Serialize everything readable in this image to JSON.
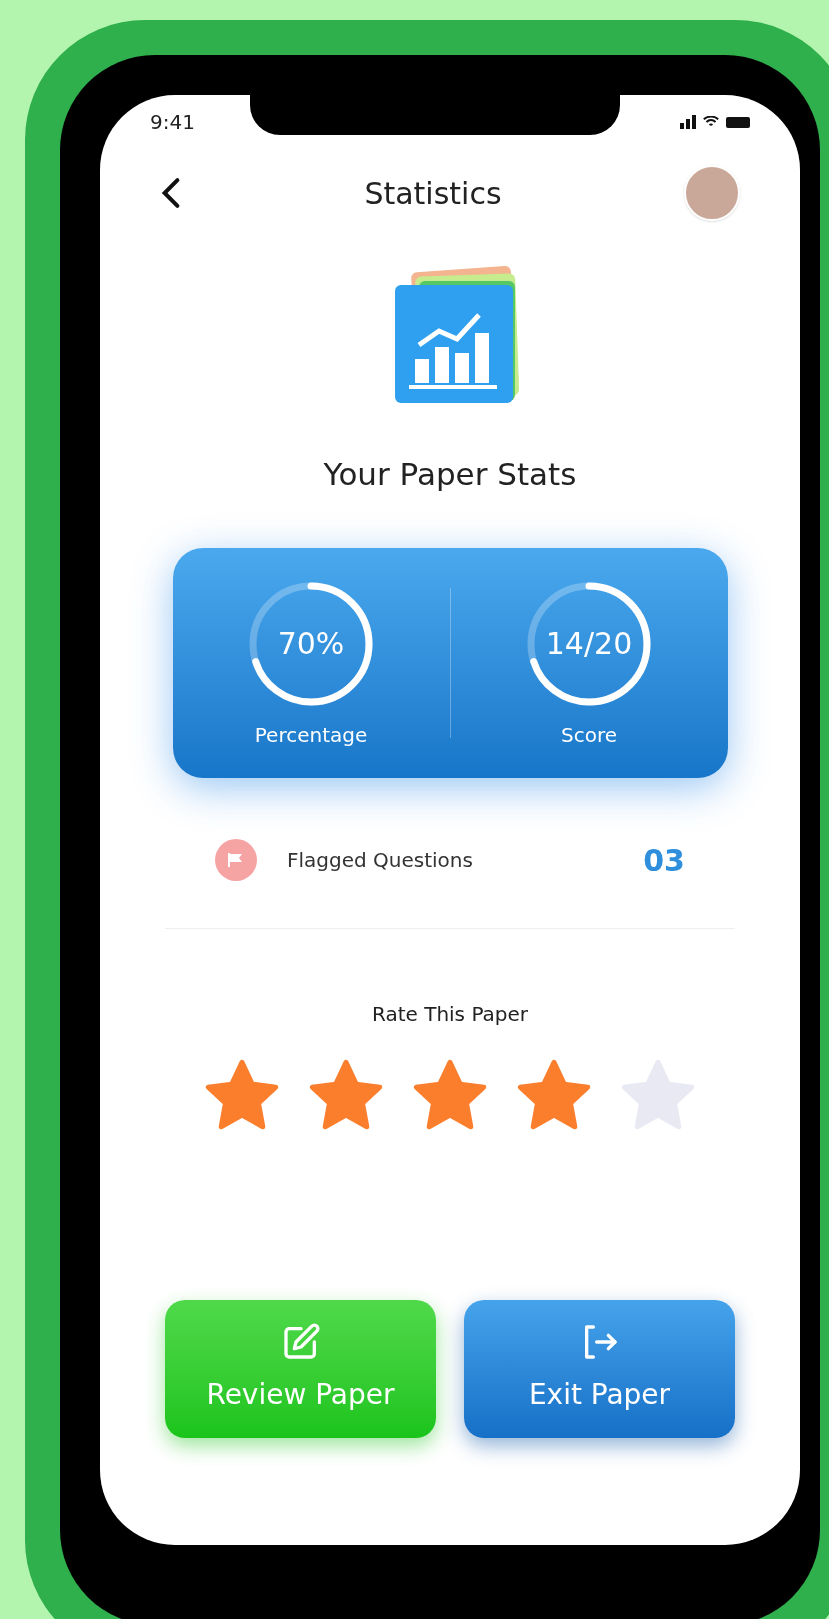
{
  "status_bar": {
    "time": "9:41"
  },
  "header": {
    "title": "Statistics"
  },
  "hero": {
    "title": "Your Paper Stats"
  },
  "stats": [
    {
      "value": "70%",
      "label": "Percentage",
      "level": 0.7
    },
    {
      "value": "14/20",
      "label": "Score",
      "level": 0.7
    }
  ],
  "flagged": {
    "label": "Flagged Questions",
    "count": "03"
  },
  "rating": {
    "title": "Rate This Paper",
    "stars": 4
  },
  "buttons": [
    {
      "label": "Review Paper",
      "kind": "review"
    },
    {
      "label": "Exit Paper",
      "kind": "exit"
    }
  ]
}
